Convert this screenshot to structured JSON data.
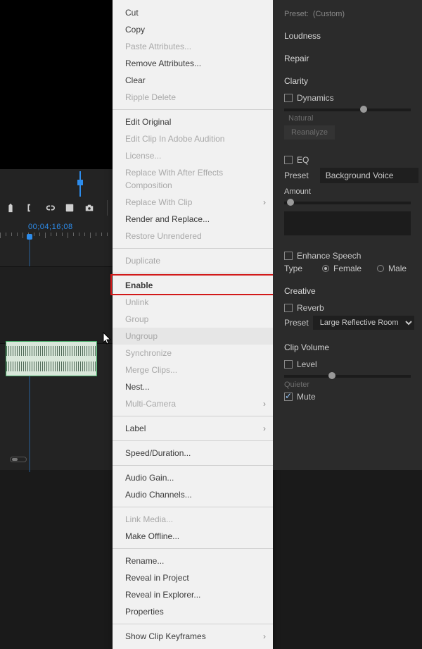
{
  "preset_top": {
    "label": "Preset:",
    "value": "(Custom)"
  },
  "timeline": {
    "timecode": "00;04;16;08"
  },
  "context_menu": {
    "items": [
      {
        "label": "Cut",
        "enabled": true
      },
      {
        "label": "Copy",
        "enabled": true
      },
      {
        "label": "Paste Attributes...",
        "enabled": false
      },
      {
        "label": "Remove Attributes...",
        "enabled": true
      },
      {
        "label": "Clear",
        "enabled": true
      },
      {
        "label": "Ripple Delete",
        "enabled": false
      },
      {
        "sep": true
      },
      {
        "label": "Edit Original",
        "enabled": true
      },
      {
        "label": "Edit Clip In Adobe Audition",
        "enabled": false
      },
      {
        "label": "License...",
        "enabled": false
      },
      {
        "label": "Replace With After Effects Composition",
        "enabled": false
      },
      {
        "label": "Replace With Clip",
        "enabled": false,
        "submenu": true
      },
      {
        "label": "Render and Replace...",
        "enabled": true
      },
      {
        "label": "Restore Unrendered",
        "enabled": false
      },
      {
        "sep": true
      },
      {
        "label": "Duplicate",
        "enabled": false
      },
      {
        "sep": true
      },
      {
        "label": "Enable",
        "enabled": true,
        "highlight": true
      },
      {
        "label": "Unlink",
        "enabled": false
      },
      {
        "label": "Group",
        "enabled": false
      },
      {
        "label": "Ungroup",
        "enabled": false,
        "hover": true
      },
      {
        "label": "Synchronize",
        "enabled": false
      },
      {
        "label": "Merge Clips...",
        "enabled": false
      },
      {
        "label": "Nest...",
        "enabled": true
      },
      {
        "label": "Multi-Camera",
        "enabled": false,
        "submenu": true
      },
      {
        "sep": true
      },
      {
        "label": "Label",
        "enabled": true,
        "submenu": true
      },
      {
        "sep": true
      },
      {
        "label": "Speed/Duration...",
        "enabled": true
      },
      {
        "sep": true
      },
      {
        "label": "Audio Gain...",
        "enabled": true
      },
      {
        "label": "Audio Channels...",
        "enabled": true
      },
      {
        "sep": true
      },
      {
        "label": "Link Media...",
        "enabled": false
      },
      {
        "label": "Make Offline...",
        "enabled": true
      },
      {
        "sep": true
      },
      {
        "label": "Rename...",
        "enabled": true
      },
      {
        "label": "Reveal in Project",
        "enabled": true
      },
      {
        "label": "Reveal in Explorer...",
        "enabled": true
      },
      {
        "label": "Properties",
        "enabled": true
      },
      {
        "sep": true
      },
      {
        "label": "Show Clip Keyframes",
        "enabled": true,
        "submenu": true
      }
    ]
  },
  "panel": {
    "loudness": "Loudness",
    "repair": "Repair",
    "clarity": "Clarity",
    "dynamics_label": "Dynamics",
    "natural": "Natural",
    "reanalyze": "Reanalyze",
    "eq_label": "EQ",
    "preset_label": "Preset",
    "eq_preset_value": "Background Voice",
    "amount": "Amount",
    "enhance_speech": "Enhance Speech",
    "type_label": "Type",
    "female": "Female",
    "male": "Male",
    "creative": "Creative",
    "reverb": "Reverb",
    "reverb_preset_value": "Large Reflective Room",
    "clip_volume": "Clip Volume",
    "level": "Level",
    "quieter": "Quieter",
    "mute": "Mute"
  }
}
